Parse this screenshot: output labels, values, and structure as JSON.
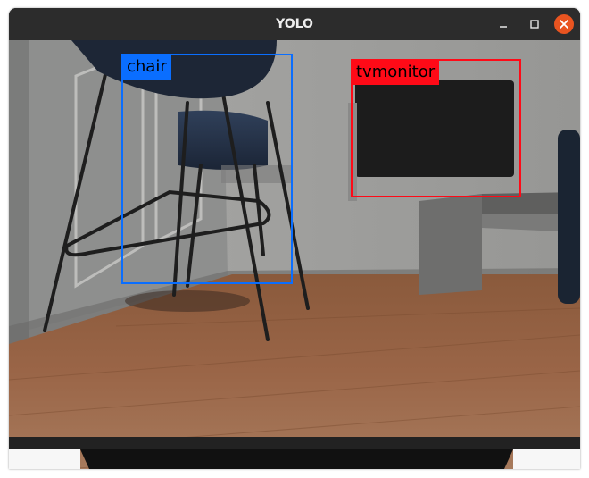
{
  "window": {
    "title": "YOLO",
    "controls": {
      "minimize": "minimize-icon",
      "maximize": "maximize-icon",
      "close": "close-icon"
    }
  },
  "detections": [
    {
      "label": "chair",
      "color": "#0a6eff"
    },
    {
      "label": "tvmonitor",
      "color": "#ff0a17"
    }
  ]
}
